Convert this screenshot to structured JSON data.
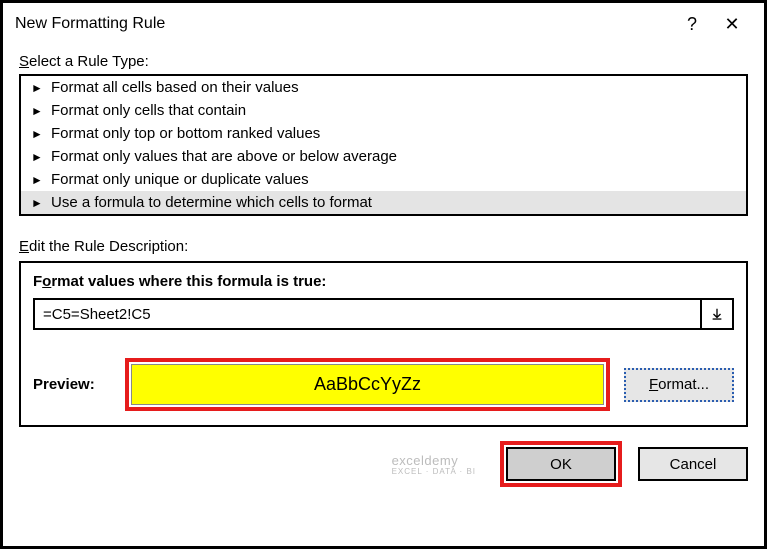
{
  "titlebar": {
    "title": "New Formatting Rule",
    "help": "?",
    "close": "✕"
  },
  "section": {
    "rule_type_prefix": "S",
    "rule_type_rest": "elect a Rule Type:",
    "edit_prefix": "E",
    "edit_rest": "dit the Rule Description:"
  },
  "rules": [
    {
      "label": "Format all cells based on their values",
      "selected": false
    },
    {
      "label": "Format only cells that contain",
      "selected": false
    },
    {
      "label": "Format only top or bottom ranked values",
      "selected": false
    },
    {
      "label": "Format only values that are above or below average",
      "selected": false
    },
    {
      "label": "Format only unique or duplicate values",
      "selected": false
    },
    {
      "label": "Use a formula to determine which cells to format",
      "selected": true
    }
  ],
  "desc": {
    "label_prefix": "o",
    "label_full": "Format values where this formula is true:",
    "formula": "=C5=Sheet2!C5"
  },
  "preview": {
    "label": "Preview:",
    "sample": "AaBbCcYyZz",
    "format_btn_prefix": "F",
    "format_btn_rest": "ormat..."
  },
  "buttons": {
    "ok": "OK",
    "cancel": "Cancel"
  },
  "watermark": {
    "main": "exceldemy",
    "sub": "EXCEL · DATA · BI"
  }
}
